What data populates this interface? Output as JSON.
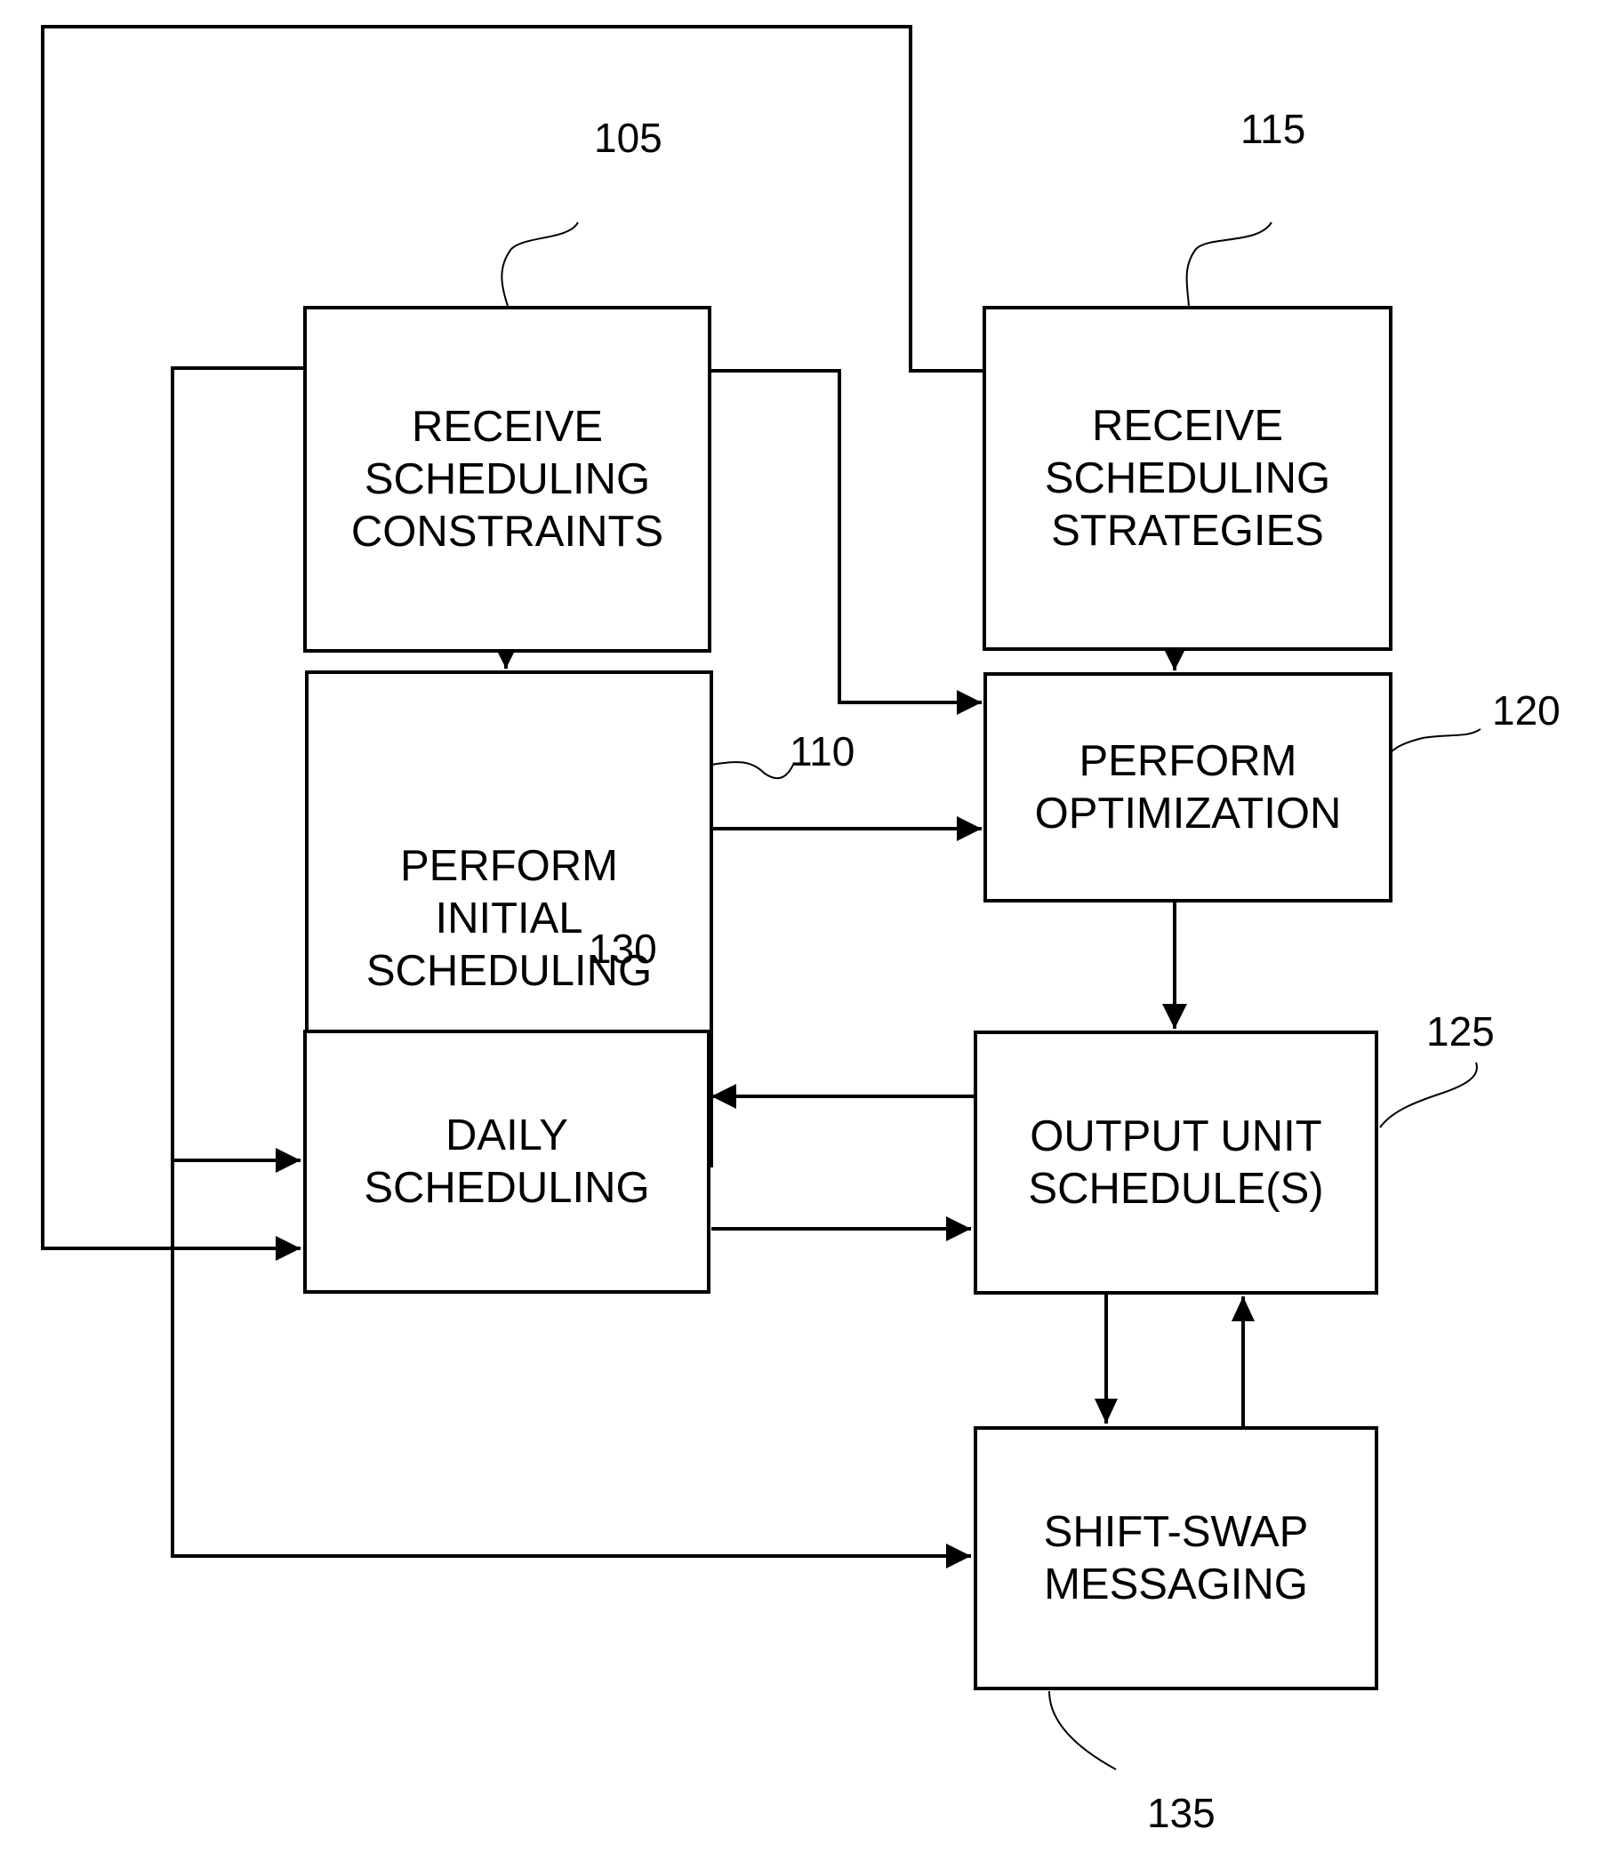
{
  "figure": {
    "boxes": [
      {
        "id": "105",
        "label": "RECEIVE\nSCHEDULING\nCONSTRAINTS"
      },
      {
        "id": "110",
        "label": "PERFORM\nINITIAL\nSCHEDULING"
      },
      {
        "id": "115",
        "label": "RECEIVE\nSCHEDULING\nSTRATEGIES"
      },
      {
        "id": "120",
        "label": "PERFORM\nOPTIMIZATION"
      },
      {
        "id": "125",
        "label": "OUTPUT UNIT\nSCHEDULE(S)"
      },
      {
        "id": "130",
        "label": "DAILY\nSCHEDULING"
      },
      {
        "id": "135",
        "label": "SHIFT-SWAP\nMESSAGING"
      }
    ],
    "refs": {
      "r105": "105",
      "r110": "110",
      "r115": "115",
      "r120": "120",
      "r125": "125",
      "r130": "130",
      "r135": "135"
    }
  }
}
